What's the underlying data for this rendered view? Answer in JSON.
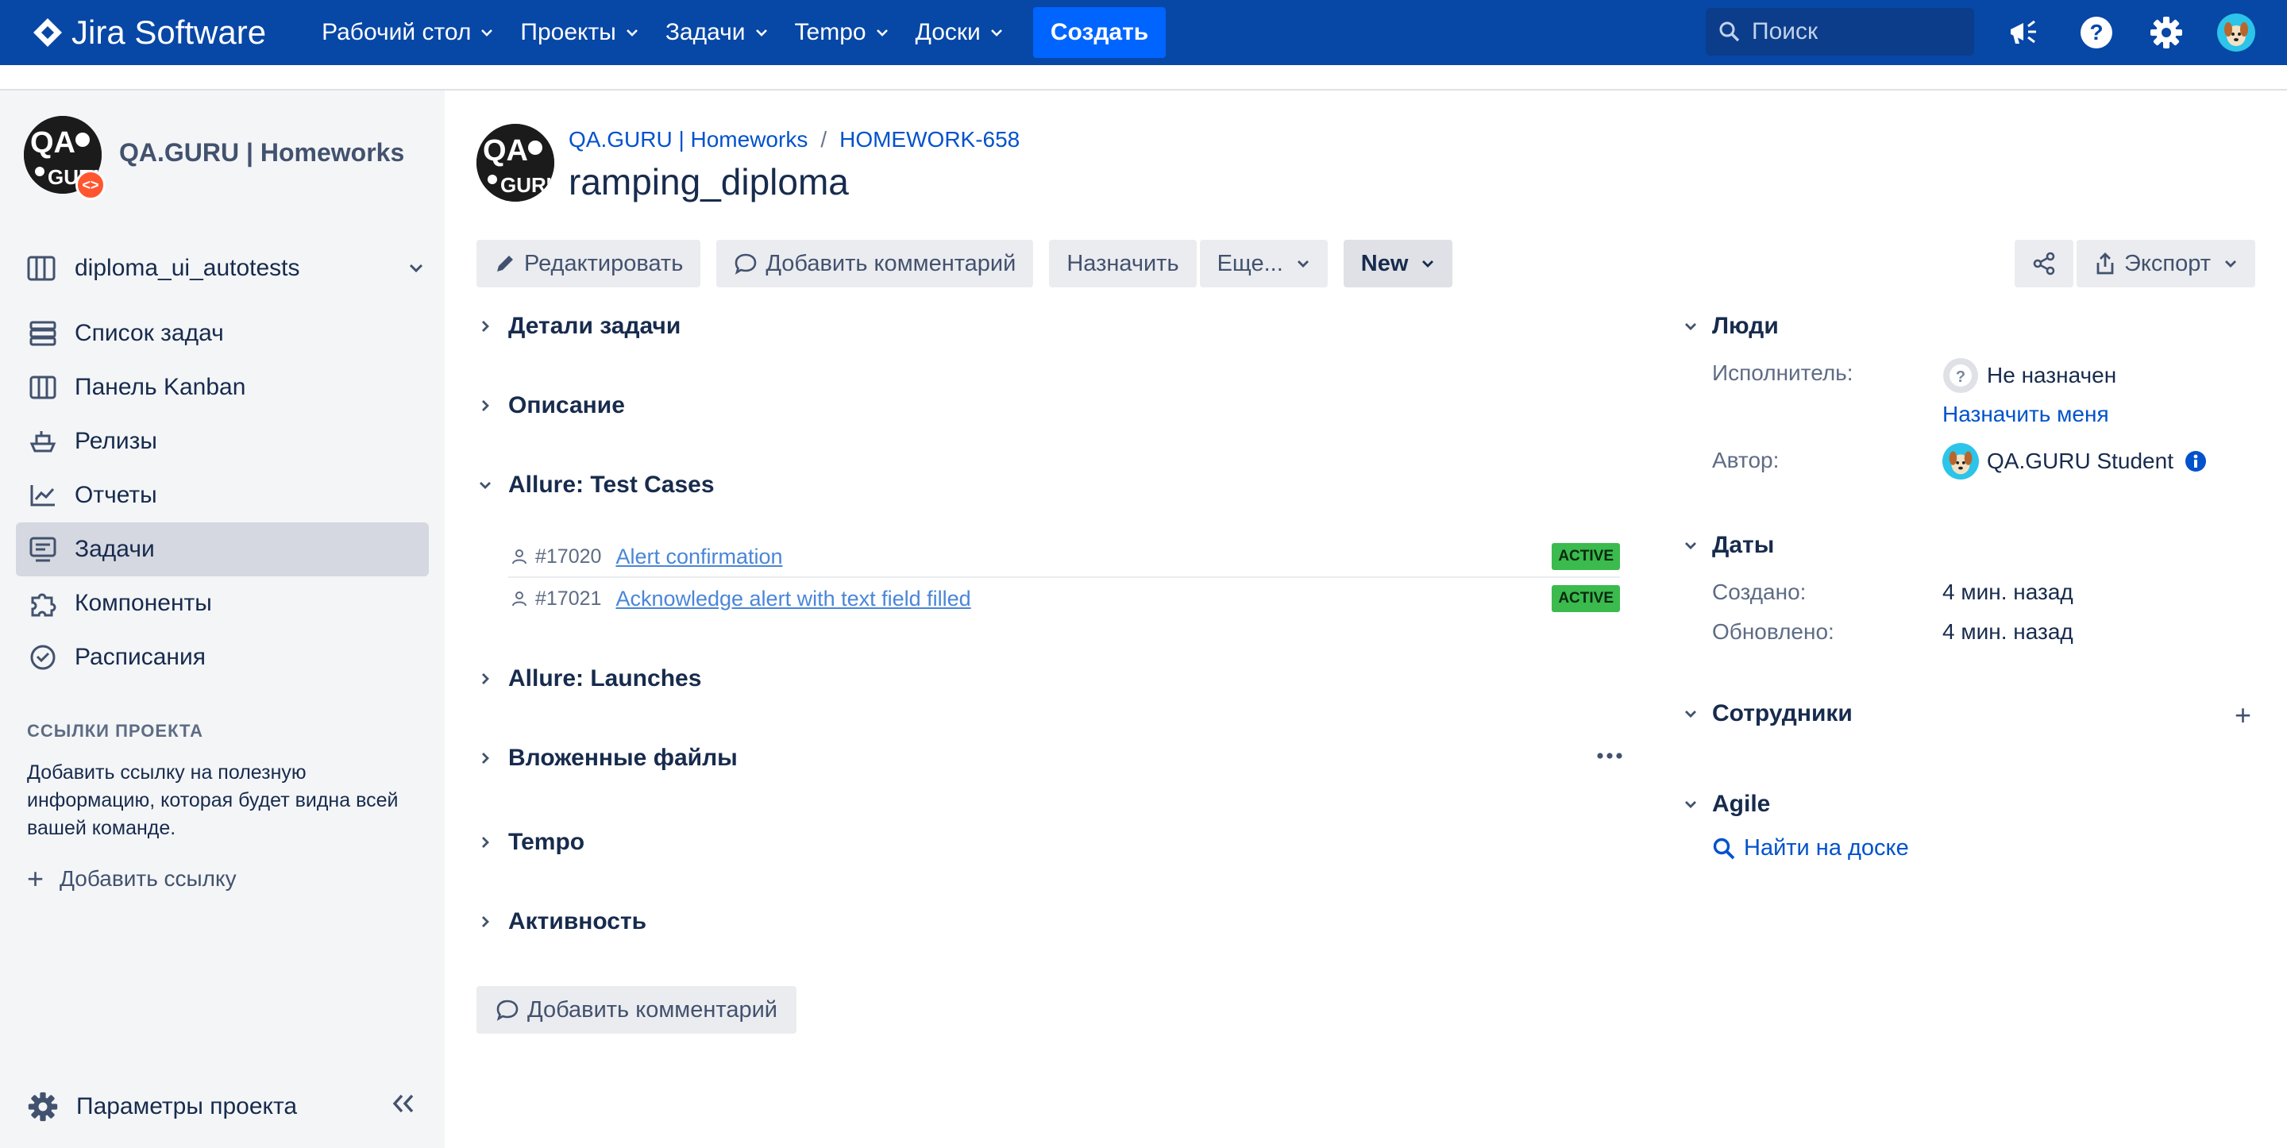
{
  "app": {
    "logo_text": "Jira Software"
  },
  "topnav": {
    "items": [
      {
        "label": "Рабочий стол"
      },
      {
        "label": "Проекты"
      },
      {
        "label": "Задачи"
      },
      {
        "label": "Tempo"
      },
      {
        "label": "Доски"
      }
    ],
    "create_label": "Создать",
    "search_placeholder": "Поиск"
  },
  "sidebar": {
    "project_name": "QA.GURU | Homeworks",
    "board_name": "diploma_ui_autotests",
    "items": [
      {
        "label": "Список задач",
        "icon": "backlog-icon"
      },
      {
        "label": "Панель Kanban",
        "icon": "board-icon"
      },
      {
        "label": "Релизы",
        "icon": "ship-icon"
      },
      {
        "label": "Отчеты",
        "icon": "reports-icon"
      },
      {
        "label": "Задачи",
        "icon": "issues-icon",
        "active": true
      },
      {
        "label": "Компоненты",
        "icon": "puzzle-icon"
      },
      {
        "label": "Расписания",
        "icon": "schedule-icon"
      }
    ],
    "links_heading": "ССЫЛКИ ПРОЕКТА",
    "links_description": "Добавить ссылку на полезную информацию, которая будет видна всей вашей команде.",
    "add_link_label": "Добавить ссылку",
    "settings_label": "Параметры проекта"
  },
  "issue": {
    "breadcrumb_project": "QA.GURU | Homeworks",
    "breadcrumb_key": "HOMEWORK-658",
    "title": "ramping_diploma",
    "toolbar": {
      "edit": "Редактировать",
      "comment": "Добавить комментарий",
      "assign": "Назначить",
      "more": "Еще...",
      "status": "New",
      "export": "Экспорт"
    },
    "sections": {
      "details": "Детали задачи",
      "description": "Описание",
      "allure_test_cases": "Allure: Test Cases",
      "allure_launches": "Allure: Launches",
      "attachments": "Вложенные файлы",
      "tempo": "Tempo",
      "activity": "Активность"
    },
    "test_cases": [
      {
        "id": "#17020",
        "name": "Alert confirmation",
        "status": "ACTIVE"
      },
      {
        "id": "#17021",
        "name": "Acknowledge alert with text field filled",
        "status": "ACTIVE"
      }
    ],
    "bottom_comment": "Добавить комментарий"
  },
  "people": {
    "heading": "Люди",
    "assignee_label": "Исполнитель:",
    "assignee_value": "Не назначен",
    "assign_me": "Назначить меня",
    "reporter_label": "Автор:",
    "reporter_value": "QA.GURU Student"
  },
  "dates": {
    "heading": "Даты",
    "created_label": "Создано:",
    "created_value": "4 мин. назад",
    "updated_label": "Обновлено:",
    "updated_value": "4 мин. назад"
  },
  "staff": {
    "heading": "Сотрудники"
  },
  "agile": {
    "heading": "Agile",
    "find_on_board": "Найти на доске"
  },
  "colors": {
    "topbar": "#0747a6",
    "create": "#0065ff",
    "link": "#0052cc",
    "active_badge": "#3bba4e"
  }
}
